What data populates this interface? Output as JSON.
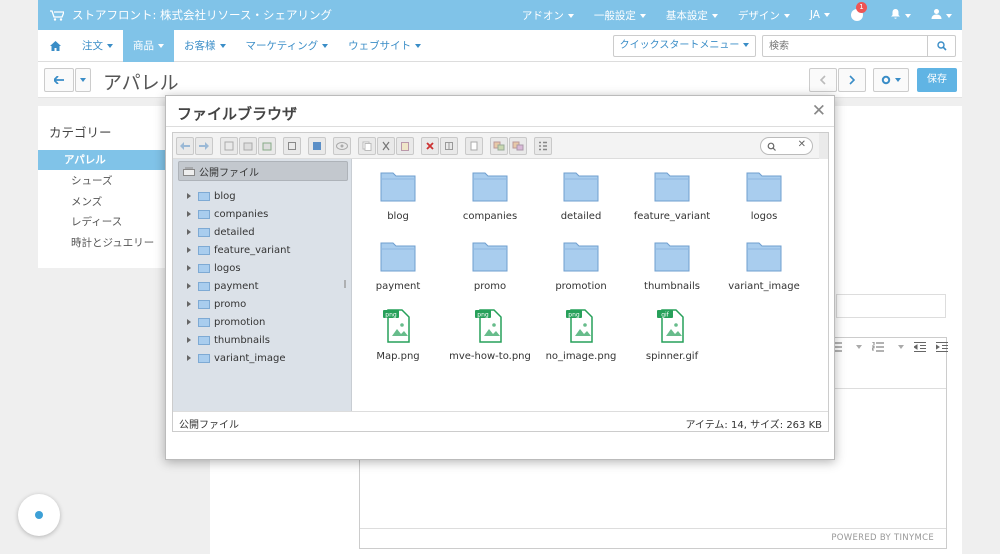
{
  "topbar": {
    "store": "ストアフロント: 株式会社リソース・シェアリング",
    "menus": [
      "アドオン",
      "一般設定",
      "基本設定",
      "デザイン",
      "JA"
    ],
    "notification_count": "1"
  },
  "nav": {
    "items": [
      "注文",
      "商品",
      "お客様",
      "マーケティング",
      "ウェブサイト"
    ],
    "active": "商品",
    "quickstart": "クイックスタートメニュー",
    "search_placeholder": "検索"
  },
  "page": {
    "title": "アパレル",
    "save_label": "保存"
  },
  "sidebar": {
    "heading": "カテゴリー",
    "categories": [
      "アパレル",
      "シューズ",
      "メンズ",
      "レディース",
      "時計とジュエリー"
    ]
  },
  "editor": {
    "powered_by": "POWERED BY TINYMCE"
  },
  "dialog": {
    "title": "ファイルブラウザ",
    "tree": {
      "root": "公開ファイル",
      "folders": [
        "blog",
        "companies",
        "detailed",
        "feature_variant",
        "logos",
        "payment",
        "promo",
        "promotion",
        "thumbnails",
        "variant_image"
      ]
    },
    "files": [
      {
        "name": "blog",
        "kind": "folder"
      },
      {
        "name": "companies",
        "kind": "folder"
      },
      {
        "name": "detailed",
        "kind": "folder"
      },
      {
        "name": "feature_variant",
        "kind": "folder"
      },
      {
        "name": "logos",
        "kind": "folder"
      },
      {
        "name": "payment",
        "kind": "folder"
      },
      {
        "name": "promo",
        "kind": "folder"
      },
      {
        "name": "promotion",
        "kind": "folder"
      },
      {
        "name": "thumbnails",
        "kind": "folder"
      },
      {
        "name": "variant_image",
        "kind": "folder"
      },
      {
        "name": "Map.png",
        "kind": "image",
        "ext": "png"
      },
      {
        "name": "mve-how-to.png",
        "kind": "image",
        "ext": "png"
      },
      {
        "name": "no_image.png",
        "kind": "image",
        "ext": "png"
      },
      {
        "name": "spinner.gif",
        "kind": "image",
        "ext": "gif"
      }
    ],
    "status_left": "公開ファイル",
    "status_right": "アイテム: 14, サイズ: 263 KB"
  },
  "colors": {
    "topbar": "#80c3e8",
    "link": "#3a8dc7",
    "folder": "#a9cdee",
    "file_badge": "#27a05a"
  }
}
